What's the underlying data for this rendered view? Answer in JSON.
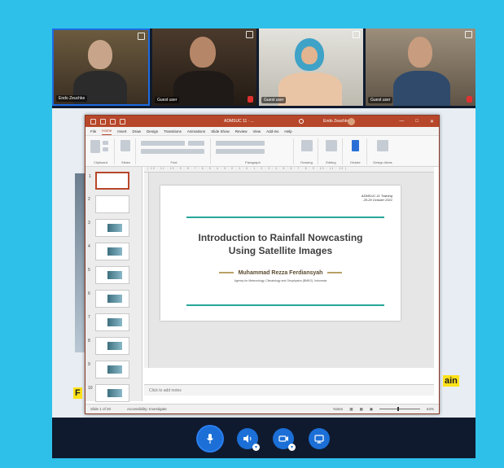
{
  "participants": [
    {
      "name": "Endo Zeuchke",
      "accent": "#1e6be0"
    },
    {
      "name": "Guest user"
    },
    {
      "name": "Guest user"
    },
    {
      "name": "Guest user"
    }
  ],
  "ppt": {
    "doc_title": "ADMSUC 11 · ...",
    "user": "Endo Zeuchke",
    "menu": [
      "File",
      "Home",
      "Insert",
      "Draw",
      "Design",
      "Transitions",
      "Animations",
      "Slide Show",
      "Review",
      "View",
      "Add-ins",
      "Help"
    ],
    "ribbon_groups": [
      "Clipboard",
      "Slides",
      "Font",
      "Paragraph",
      "Drawing",
      "Editing",
      "Dictate",
      "Design Ideas"
    ],
    "slide": {
      "tag_line1": "ADMSUC-11 Training",
      "tag_line2": "28-29 October 2021",
      "title_line1": "Introduction to Rainfall Nowcasting",
      "title_line2": "Using Satellite Images",
      "author": "Muhammad Rezza Ferdiansyah",
      "agency": "Agency for Meteorology, Climatology and Geophysics (BMKG), Indonesia"
    },
    "thumb_numbers": [
      "1",
      "2",
      "3",
      "4",
      "5",
      "6",
      "7",
      "8",
      "9",
      "10"
    ],
    "notes_placeholder": "Click to add notes",
    "status_slide": "Slide 1 of 20",
    "status_access": "Accessibility: Investigate",
    "status_notes": "Notes",
    "zoom": "64%"
  },
  "background_text": {
    "left": "F",
    "right": "ain"
  },
  "controls": [
    "microphone-icon",
    "speaker-icon",
    "camera-icon",
    "share-screen-icon"
  ]
}
